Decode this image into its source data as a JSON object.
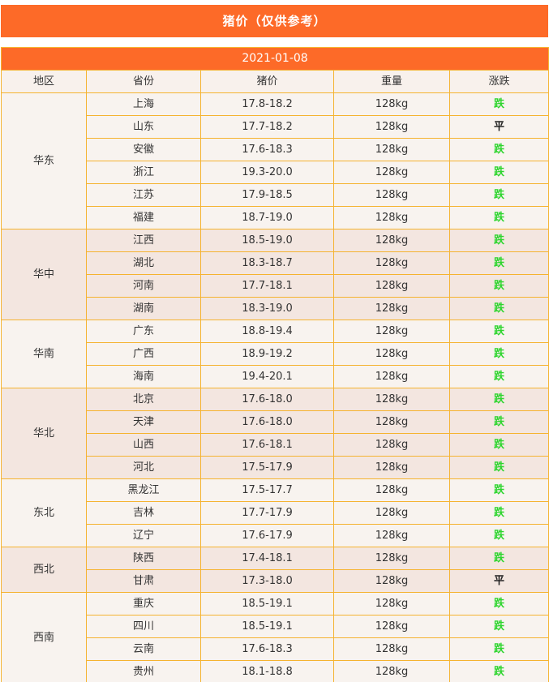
{
  "title": "猪价（仅供参考）",
  "date": "2021-01-08",
  "headers": [
    "地区",
    "省份",
    "猪价",
    "重量",
    "涨跌"
  ],
  "colors": {
    "accent": "#fd6a28",
    "border": "#f5b330",
    "down": "#2fd52f",
    "flat": "#222222"
  },
  "groups": [
    {
      "region": "华东",
      "rows": [
        {
          "province": "上海",
          "price": "17.8-18.2",
          "weight": "128kg",
          "trend": "跌"
        },
        {
          "province": "山东",
          "price": "17.7-18.2",
          "weight": "128kg",
          "trend": "平"
        },
        {
          "province": "安徽",
          "price": "17.6-18.3",
          "weight": "128kg",
          "trend": "跌"
        },
        {
          "province": "浙江",
          "price": "19.3-20.0",
          "weight": "128kg",
          "trend": "跌"
        },
        {
          "province": "江苏",
          "price": "17.9-18.5",
          "weight": "128kg",
          "trend": "跌"
        },
        {
          "province": "福建",
          "price": "18.7-19.0",
          "weight": "128kg",
          "trend": "跌"
        }
      ]
    },
    {
      "region": "华中",
      "rows": [
        {
          "province": "江西",
          "price": "18.5-19.0",
          "weight": "128kg",
          "trend": "跌"
        },
        {
          "province": "湖北",
          "price": "18.3-18.7",
          "weight": "128kg",
          "trend": "跌"
        },
        {
          "province": "河南",
          "price": "17.7-18.1",
          "weight": "128kg",
          "trend": "跌"
        },
        {
          "province": "湖南",
          "price": "18.3-19.0",
          "weight": "128kg",
          "trend": "跌"
        }
      ]
    },
    {
      "region": "华南",
      "rows": [
        {
          "province": "广东",
          "price": "18.8-19.4",
          "weight": "128kg",
          "trend": "跌"
        },
        {
          "province": "广西",
          "price": "18.9-19.2",
          "weight": "128kg",
          "trend": "跌"
        },
        {
          "province": "海南",
          "price": "19.4-20.1",
          "weight": "128kg",
          "trend": "跌"
        }
      ]
    },
    {
      "region": "华北",
      "rows": [
        {
          "province": "北京",
          "price": "17.6-18.0",
          "weight": "128kg",
          "trend": "跌"
        },
        {
          "province": "天津",
          "price": "17.6-18.0",
          "weight": "128kg",
          "trend": "跌"
        },
        {
          "province": "山西",
          "price": "17.6-18.1",
          "weight": "128kg",
          "trend": "跌"
        },
        {
          "province": "河北",
          "price": "17.5-17.9",
          "weight": "128kg",
          "trend": "跌"
        }
      ]
    },
    {
      "region": "东北",
      "rows": [
        {
          "province": "黑龙江",
          "price": "17.5-17.7",
          "weight": "128kg",
          "trend": "跌"
        },
        {
          "province": "吉林",
          "price": "17.7-17.9",
          "weight": "128kg",
          "trend": "跌"
        },
        {
          "province": "辽宁",
          "price": "17.6-17.9",
          "weight": "128kg",
          "trend": "跌"
        }
      ]
    },
    {
      "region": "西北",
      "rows": [
        {
          "province": "陕西",
          "price": "17.4-18.1",
          "weight": "128kg",
          "trend": "跌"
        },
        {
          "province": "甘肃",
          "price": "17.3-18.0",
          "weight": "128kg",
          "trend": "平"
        }
      ]
    },
    {
      "region": "西南",
      "rows": [
        {
          "province": "重庆",
          "price": "18.5-19.1",
          "weight": "128kg",
          "trend": "跌"
        },
        {
          "province": "四川",
          "price": "18.5-19.1",
          "weight": "128kg",
          "trend": "跌"
        },
        {
          "province": "云南",
          "price": "17.6-18.3",
          "weight": "128kg",
          "trend": "跌"
        },
        {
          "province": "贵州",
          "price": "18.1-18.8",
          "weight": "128kg",
          "trend": "跌"
        }
      ]
    }
  ]
}
